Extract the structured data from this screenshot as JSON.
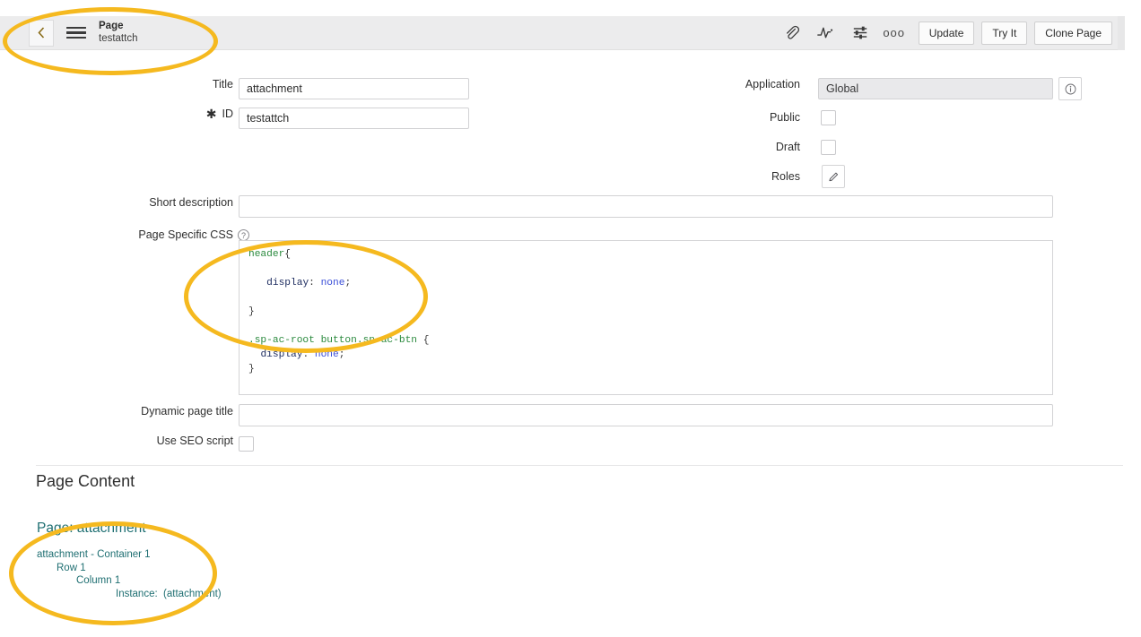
{
  "header": {
    "back_label": "‹",
    "menu_label": "menu",
    "kicker": "Page",
    "subtitle": "testattch",
    "icons": {
      "attachment": "paperclip-icon",
      "activity": "activity-wave-icon",
      "filter": "sliders-icon",
      "more": "ooo"
    },
    "buttons": {
      "update": "Update",
      "try_it": "Try It",
      "clone_page": "Clone Page"
    }
  },
  "form": {
    "title_label": "Title",
    "title_value": "attachment",
    "id_label": "ID",
    "id_required_marker": "✱",
    "id_value": "testattch",
    "application_label": "Application",
    "application_value": "Global",
    "application_info_icon": "info-icon",
    "public_label": "Public",
    "public_checked": false,
    "draft_label": "Draft",
    "draft_checked": false,
    "roles_label": "Roles",
    "roles_edit_icon": "pencil-icon",
    "short_description_label": "Short description",
    "short_description_value": "",
    "page_specific_css_label": "Page Specific CSS",
    "page_specific_css_help": "?",
    "dynamic_page_title_label": "Dynamic page title",
    "dynamic_page_title_value": "",
    "use_seo_script_label": "Use SEO script",
    "use_seo_script_checked": false
  },
  "css_editor": {
    "lines": [
      "header{",
      "",
      "   display: none;",
      "",
      "}",
      "",
      ".sp-ac-root button.sp-ac-btn {",
      "  display: none;",
      "}"
    ],
    "tokens": {
      "sel1": "header",
      "brace_open": "{",
      "prop": "display",
      "colon": ":",
      "value": "none",
      "semi": ";",
      "brace_close": "}",
      "sel2_a": ".sp-ac-root",
      "sel2_b": "button.sp-ac-btn"
    },
    "colors": {
      "selector": "#2b8a3e",
      "property": "#1b2a5e",
      "value": "#3b4fd8",
      "punctuation": "#3a3a3a"
    }
  },
  "page_content": {
    "section_title": "Page Content",
    "tree_heading": "Page: attachment",
    "tree": [
      {
        "indent": 0,
        "label": "attachment - Container 1"
      },
      {
        "indent": 1,
        "label": "Row 1"
      },
      {
        "indent": 2,
        "label": "Column 1"
      },
      {
        "indent": 4,
        "label": "Instance:  (attachment)"
      }
    ],
    "tree_color": "#1f6f72"
  },
  "annotations": {
    "color": "#f5b91f",
    "regions": [
      "header-back-menu-area",
      "page-specific-css-code",
      "page-content-tree"
    ]
  }
}
